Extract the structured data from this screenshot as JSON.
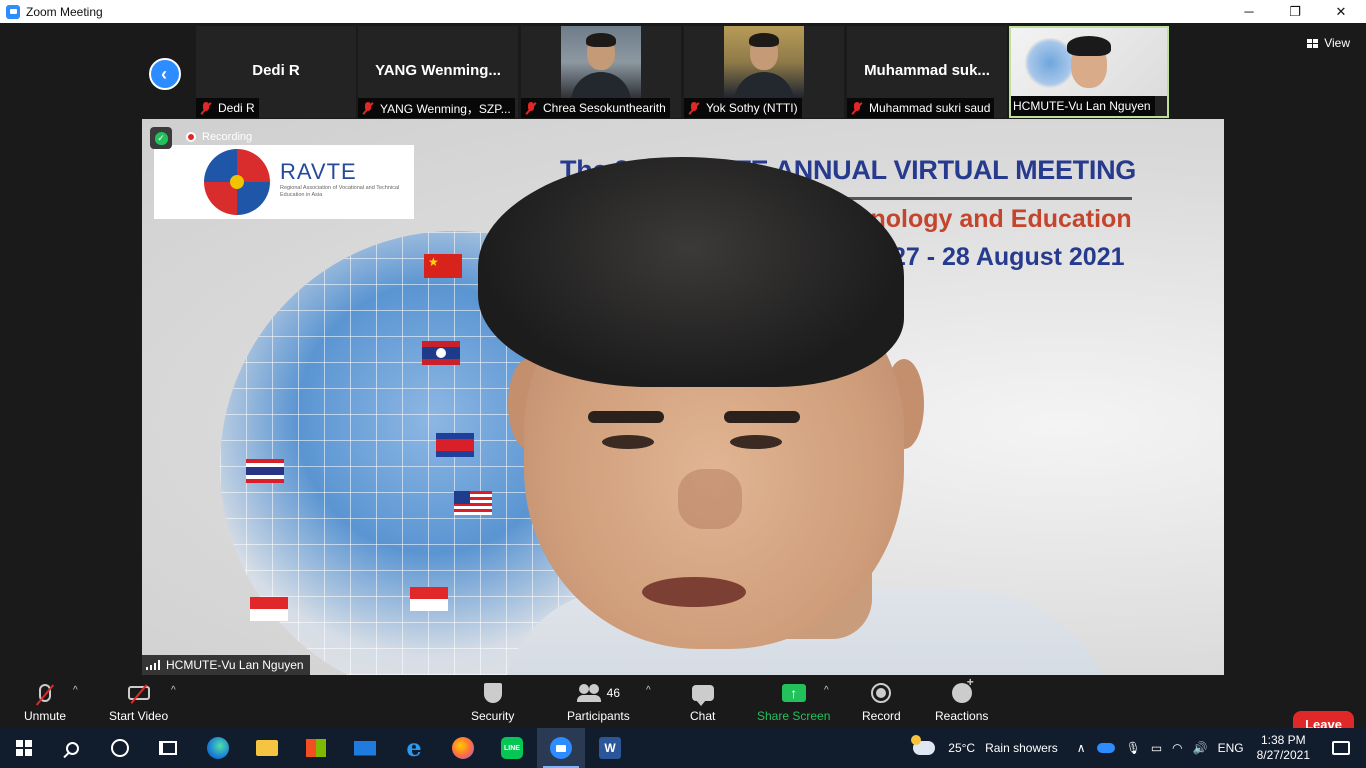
{
  "window": {
    "title": "Zoom Meeting",
    "minimize": "─",
    "maximize": "❐",
    "close": "✕"
  },
  "thumbnails": [
    {
      "name": "Dedi R",
      "big_name": "Dedi R",
      "muted": true
    },
    {
      "name": "YANG Wenming，SZP...",
      "big_name": "YANG  Wenming...",
      "muted": true
    },
    {
      "name": "Chrea Sesokunthearith",
      "muted": true
    },
    {
      "name": "Yok Sothy (NTTI)",
      "muted": true
    },
    {
      "name": "Muhammad sukri saud",
      "big_name": "Muhammad  suk...",
      "muted": true
    },
    {
      "name": "HCMUTE-Vu Lan Nguyen",
      "muted": false
    }
  ],
  "view_button": "View",
  "main_video": {
    "speaker": "HCMUTE-Vu Lan Nguyen",
    "recording_label": "Recording",
    "slide": {
      "logo_title": "RAVTE",
      "logo_subtitle": "Regional Association of Vocational and Technical Education in Asia",
      "title_line1": "The 2021 RAVTE ANNUAL VIRTUAL MEETING",
      "title_line2": "Technology and Education",
      "date": "27 - 28 August 2021"
    }
  },
  "toolbar": {
    "unmute": "Unmute",
    "start_video": "Start Video",
    "security": "Security",
    "participants": "Participants",
    "participant_count": "46",
    "chat": "Chat",
    "share_screen": "Share Screen",
    "record": "Record",
    "reactions": "Reactions",
    "leave": "Leave",
    "caret": "^"
  },
  "taskbar": {
    "weather_temp": "25°C",
    "weather_desc": "Rain showers",
    "language": "ENG",
    "time": "1:38 PM",
    "date": "8/27/2021",
    "line_label": "LINE",
    "word_label": "W",
    "ie_label": "e"
  }
}
